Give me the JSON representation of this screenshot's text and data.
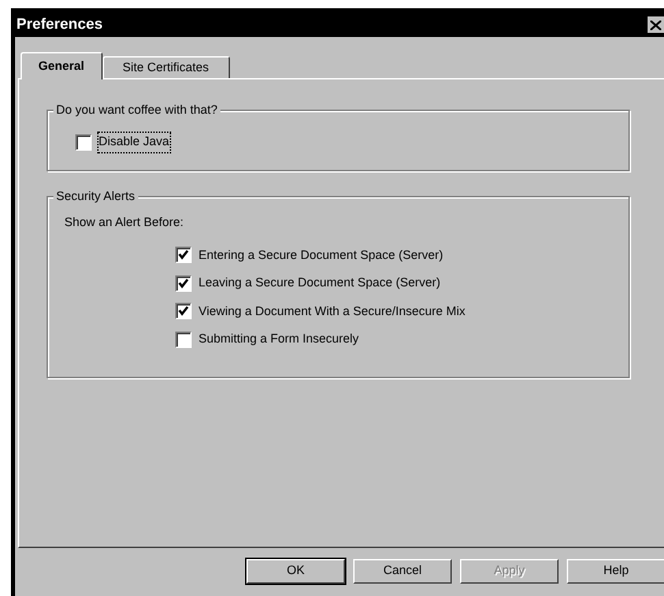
{
  "window": {
    "title": "Preferences"
  },
  "tabs": [
    {
      "label": "General",
      "selected": true
    },
    {
      "label": "Site Certificates",
      "selected": false
    }
  ],
  "groups": [
    {
      "title": "Do you want coffee with that?",
      "items": [
        {
          "kind": "checkbox",
          "label": "Disable Java",
          "checked": false,
          "focused": true
        }
      ]
    },
    {
      "title": "Security Alerts",
      "items": [
        {
          "kind": "text",
          "label": "Show an Alert Before:"
        },
        {
          "kind": "checkbox",
          "label": "Entering a Secure Document Space (Server)",
          "checked": true
        },
        {
          "kind": "checkbox",
          "label": "Leaving a Secure Document Space (Server)",
          "checked": true
        },
        {
          "kind": "checkbox",
          "label": "Viewing a Document With a Secure/Insecure Mix",
          "checked": true
        },
        {
          "kind": "checkbox",
          "label": "Submitting a Form Insecurely",
          "checked": false
        }
      ]
    }
  ],
  "buttons": [
    {
      "label": "OK",
      "disabled": false,
      "default": true
    },
    {
      "label": "Cancel",
      "disabled": false,
      "default": false
    },
    {
      "label": "Apply",
      "disabled": true,
      "default": false
    },
    {
      "label": "Help",
      "disabled": false,
      "default": false
    }
  ]
}
